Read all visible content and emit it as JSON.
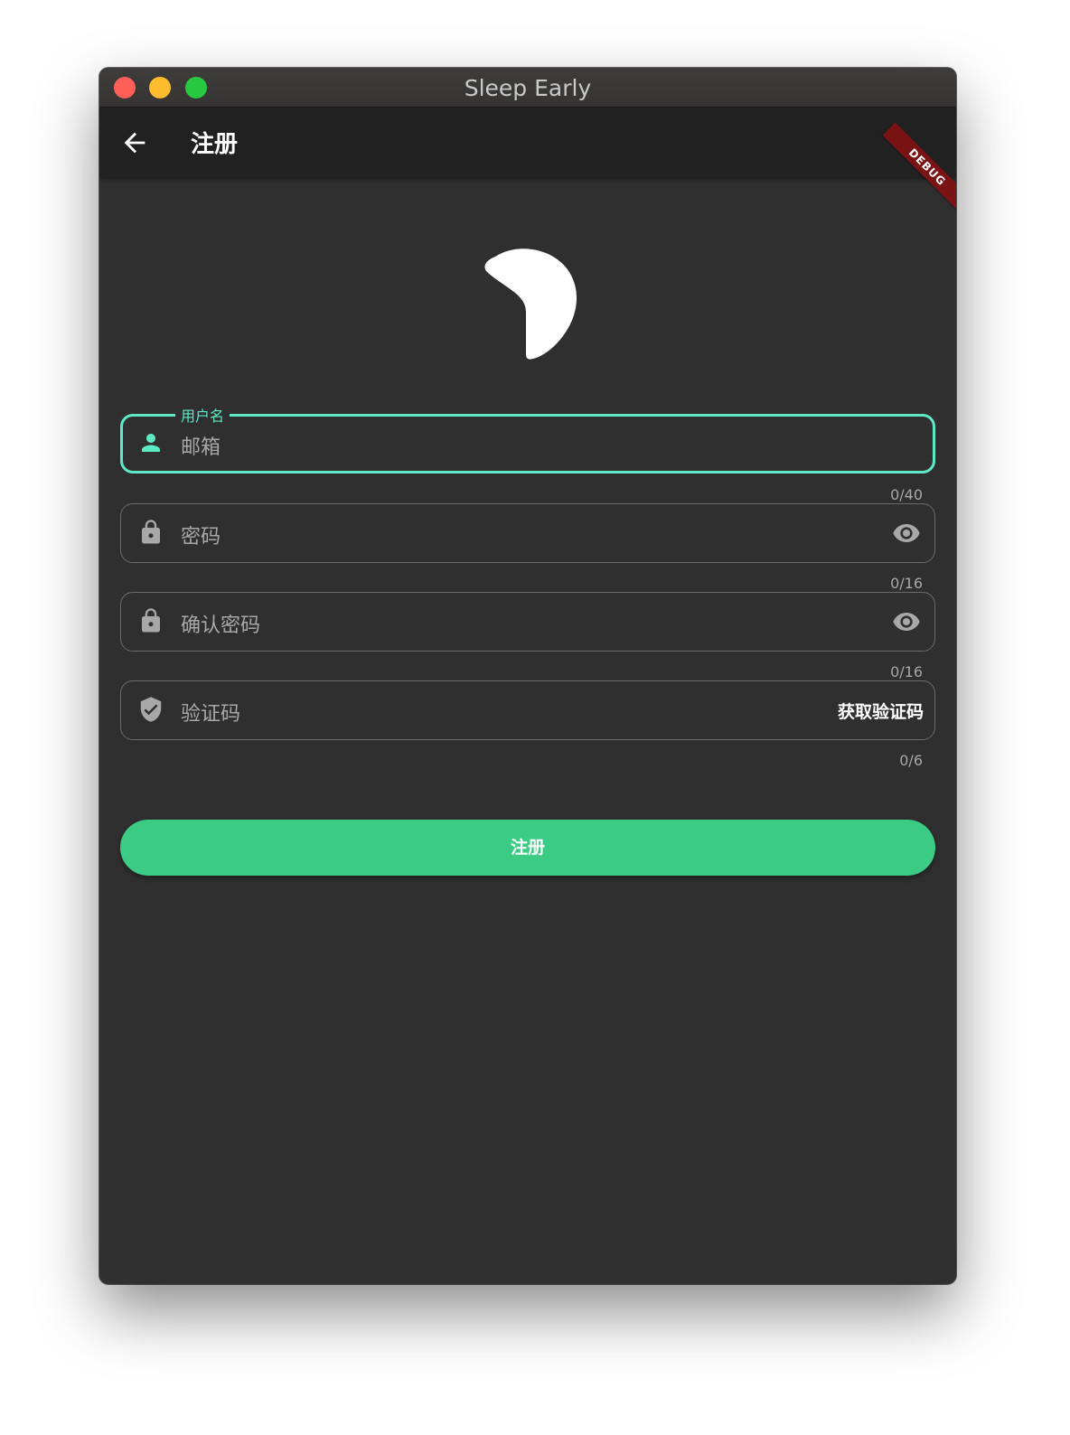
{
  "window": {
    "title": "Sleep Early"
  },
  "appbar": {
    "back_icon": "arrow-back-icon",
    "title": "注册",
    "debug_banner": "DEBUG"
  },
  "logo": {
    "icon": "crescent-moon-logo"
  },
  "form": {
    "username": {
      "label": "用户名",
      "placeholder": "邮箱",
      "icon": "person-icon",
      "counter": "0/40"
    },
    "password": {
      "placeholder": "密码",
      "icon": "lock-icon",
      "toggle_icon": "eye-icon",
      "counter": "0/16"
    },
    "confirm_password": {
      "placeholder": "确认密码",
      "icon": "lock-icon",
      "toggle_icon": "eye-icon",
      "counter": "0/16"
    },
    "verification_code": {
      "placeholder": "验证码",
      "icon": "shield-check-icon",
      "action_label": "获取验证码",
      "counter": "0/6"
    },
    "submit_label": "注册"
  },
  "colors": {
    "accent": "#5ee9c6",
    "submit": "#3bcb84",
    "background": "#2f2f2f",
    "appbar": "#212121",
    "debug": "#7a1414"
  }
}
